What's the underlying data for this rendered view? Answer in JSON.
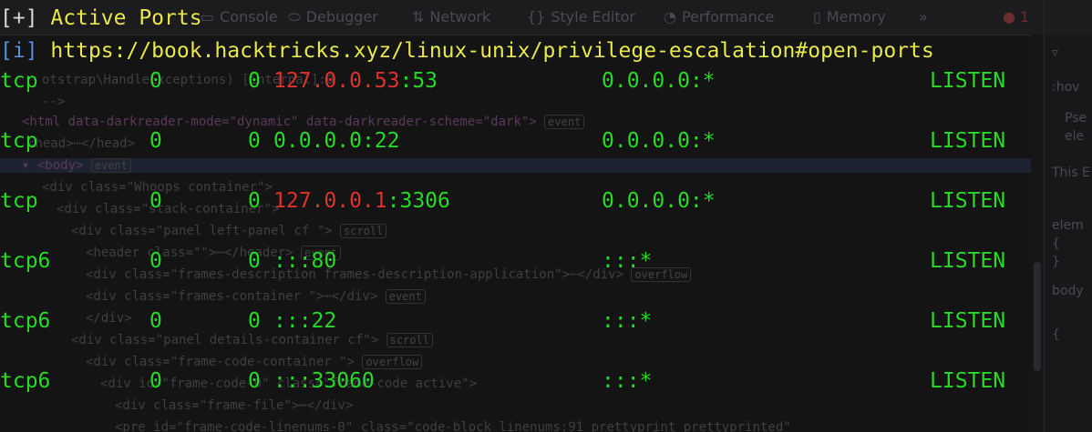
{
  "devtools": {
    "tabs": [
      {
        "label": "Console",
        "icon": "console-icon",
        "glyph": "▭"
      },
      {
        "label": "Debugger",
        "icon": "debugger-icon",
        "glyph": "⬭"
      },
      {
        "label": "Network",
        "icon": "network-icon",
        "glyph": "⇅"
      },
      {
        "label": "Style Editor",
        "icon": "style-editor-icon",
        "glyph": "{}"
      },
      {
        "label": "Performance",
        "icon": "performance-icon",
        "glyph": "◔"
      },
      {
        "label": "Memory",
        "icon": "memory-icon",
        "glyph": "▯"
      }
    ],
    "overflow": "»",
    "error_count": "1",
    "side_texts": [
      ":hov",
      "Pse",
      "ele",
      "This E",
      "elem",
      "{",
      "}",
      "body",
      "{"
    ],
    "code_lines": [
      "otstrap\\HandleExceptions) [internal]:0",
      "-->",
      "<html data-darkreader-mode=\"dynamic\" data-darkreader-scheme=\"dark\">",
      "<head>⋯</head>",
      "▾ <body>",
      "<div class=\"Whoops container\">",
      "<div class=\"stack-container\">",
      "<div class=\"panel left-panel cf \">",
      "<header class=\"\">⋯</header>",
      "<div class=\"frames-description frames-description-application\">⋯</div>",
      "<div class=\"frames-container \">⋯</div>",
      "</div>",
      "<div class=\"panel details-container cf\">",
      "<div class=\"frame-code-container \">",
      "<div id=\"frame-code-0\" class=\"frame-code active\">",
      "<div class=\"frame-file\">⋯</div>",
      "<pre id=\"frame-code-linenums-0\" class=\"code-block linenums:91 prettyprint prettyprinted\""
    ],
    "badges": [
      "event",
      "event",
      "scroll",
      "event",
      "overflow",
      "event",
      "scroll",
      "overflow"
    ]
  },
  "terminal": {
    "header": {
      "prefix": "[+]",
      "text": "Active Ports"
    },
    "info": {
      "prefix": "[i]",
      "text": "https://book.hacktricks.xyz/linux-unix/privilege-escalation#open-ports"
    },
    "rows": [
      {
        "proto": "tcp",
        "recvq": "0",
        "sendq": "0",
        "local_ip": "127.0.0.53",
        "local_port": ":53",
        "foreign": "0.0.0.0:*",
        "state": "LISTEN",
        "highlight": true
      },
      {
        "proto": "tcp",
        "recvq": "0",
        "sendq": "0",
        "local_ip": "0.0.0.0",
        "local_port": ":22",
        "foreign": "0.0.0.0:*",
        "state": "LISTEN",
        "highlight": false
      },
      {
        "proto": "tcp",
        "recvq": "0",
        "sendq": "0",
        "local_ip": "127.0.0.1",
        "local_port": ":3306",
        "foreign": "0.0.0.0:*",
        "state": "LISTEN",
        "highlight": true
      },
      {
        "proto": "tcp6",
        "recvq": "0",
        "sendq": "0",
        "local_ip": "",
        "local_port": ":::80",
        "foreign": ":::*",
        "state": "LISTEN",
        "highlight": false
      },
      {
        "proto": "tcp6",
        "recvq": "0",
        "sendq": "0",
        "local_ip": "",
        "local_port": ":::22",
        "foreign": ":::*",
        "state": "LISTEN",
        "highlight": false
      },
      {
        "proto": "tcp6",
        "recvq": "0",
        "sendq": "0",
        "local_ip": "",
        "local_port": ":::33060",
        "foreign": ":::*",
        "state": "LISTEN",
        "highlight": false
      }
    ],
    "colors": {
      "green": "#26dc26",
      "red": "#e0322e",
      "yellow": "#e9e94a",
      "info_blue": "#5c8fd6"
    }
  }
}
